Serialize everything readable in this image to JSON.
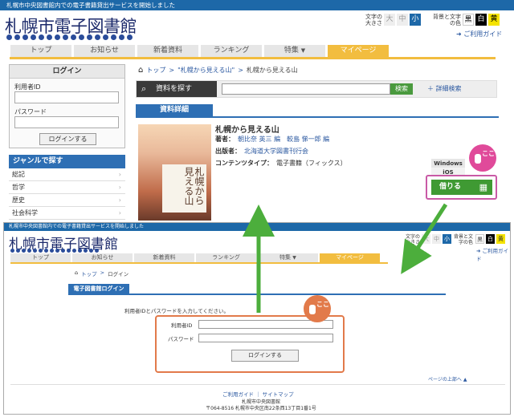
{
  "top": {
    "banner": "札幌市中央図書館内での電子書籍貸出サービスを開始しました",
    "logo": "札幌市電子図書館",
    "font_size": {
      "label": "文字の大きさ",
      "options": [
        "大",
        "中",
        "小"
      ],
      "selected": "小"
    },
    "color_scheme": {
      "label": "背景と文字の色",
      "options": [
        "黒",
        "白",
        "黄"
      ],
      "colors": [
        "#000000",
        "#ffffff",
        "#f5e300"
      ]
    },
    "guide_link": "ご利用ガイド",
    "nav": [
      "トップ",
      "お知らせ",
      "新着資料",
      "ランキング",
      "特集",
      "マイページ"
    ],
    "nav_active": "マイページ",
    "nav_dropdown_tab": "特集",
    "sidebar": {
      "login_title": "ログイン",
      "user_id_label": "利用者ID",
      "password_label": "パスワード",
      "login_button": "ログインする",
      "genre_title": "ジャンルで探す",
      "genres": [
        "総記",
        "哲学",
        "歴史",
        "社会科学"
      ]
    },
    "breadcrumb": [
      "トップ",
      "\"札幌から見える山\"",
      "札幌から見える山"
    ],
    "search": {
      "label": "資料を探す",
      "button": "検索",
      "advanced": "詳細検索"
    },
    "detail_tab": "資料詳細",
    "book": {
      "cover_title": "札幌から見える山",
      "title": "札幌から見える山",
      "author_label": "著者：",
      "authors": "朝比奈 英三 編　較島 悌一郎 編",
      "publisher_label": "出版者：",
      "publisher": "北海道大学図書刊行会",
      "content_type_label": "コンテンツタイプ：",
      "content_type": "電子書籍（フィックス）"
    },
    "platforms": [
      "Windows",
      "iOS"
    ],
    "borrow_button": "借りる",
    "callout": "ここ"
  },
  "inset": {
    "banner": "札幌市中央図書館内での電子書籍貸出サービスを開始しました",
    "logo": "札幌市電子図書館",
    "font_size": {
      "label": "文字の大きさ",
      "options": [
        "大",
        "中",
        "小"
      ],
      "selected": "小"
    },
    "color_scheme": {
      "label": "背景と文字の色",
      "options": [
        "黒",
        "白",
        "黄"
      ]
    },
    "guide_link": "ご利用ガイド",
    "nav": [
      "トップ",
      "お知らせ",
      "新着資料",
      "ランキング",
      "特集",
      "マイページ"
    ],
    "nav_active": "マイページ",
    "breadcrumb": [
      "トップ",
      "ログイン"
    ],
    "tab": "電子図書館ログイン",
    "instruction": "利用者IDとパスワードを入力してください。",
    "user_id_label": "利用者ID",
    "password_label": "パスワード",
    "login_button": "ログインする",
    "callout": "ここ",
    "page_top": "ページの上部へ",
    "footer_links": [
      "ご利用ガイド",
      "サイトマップ"
    ],
    "footer_org": "札幌市中央図書館",
    "footer_address": "〒064-8516 札幌市中央区南22条西13丁目1番1号"
  },
  "colors": {
    "header_blue": "#1d68a8",
    "nav_active": "#f2bd3f",
    "borrow_green": "#3f9a33",
    "callout_pink": "#e04a9a",
    "callout_orange": "#e27a4a",
    "arrow_green": "#4cae3c"
  }
}
